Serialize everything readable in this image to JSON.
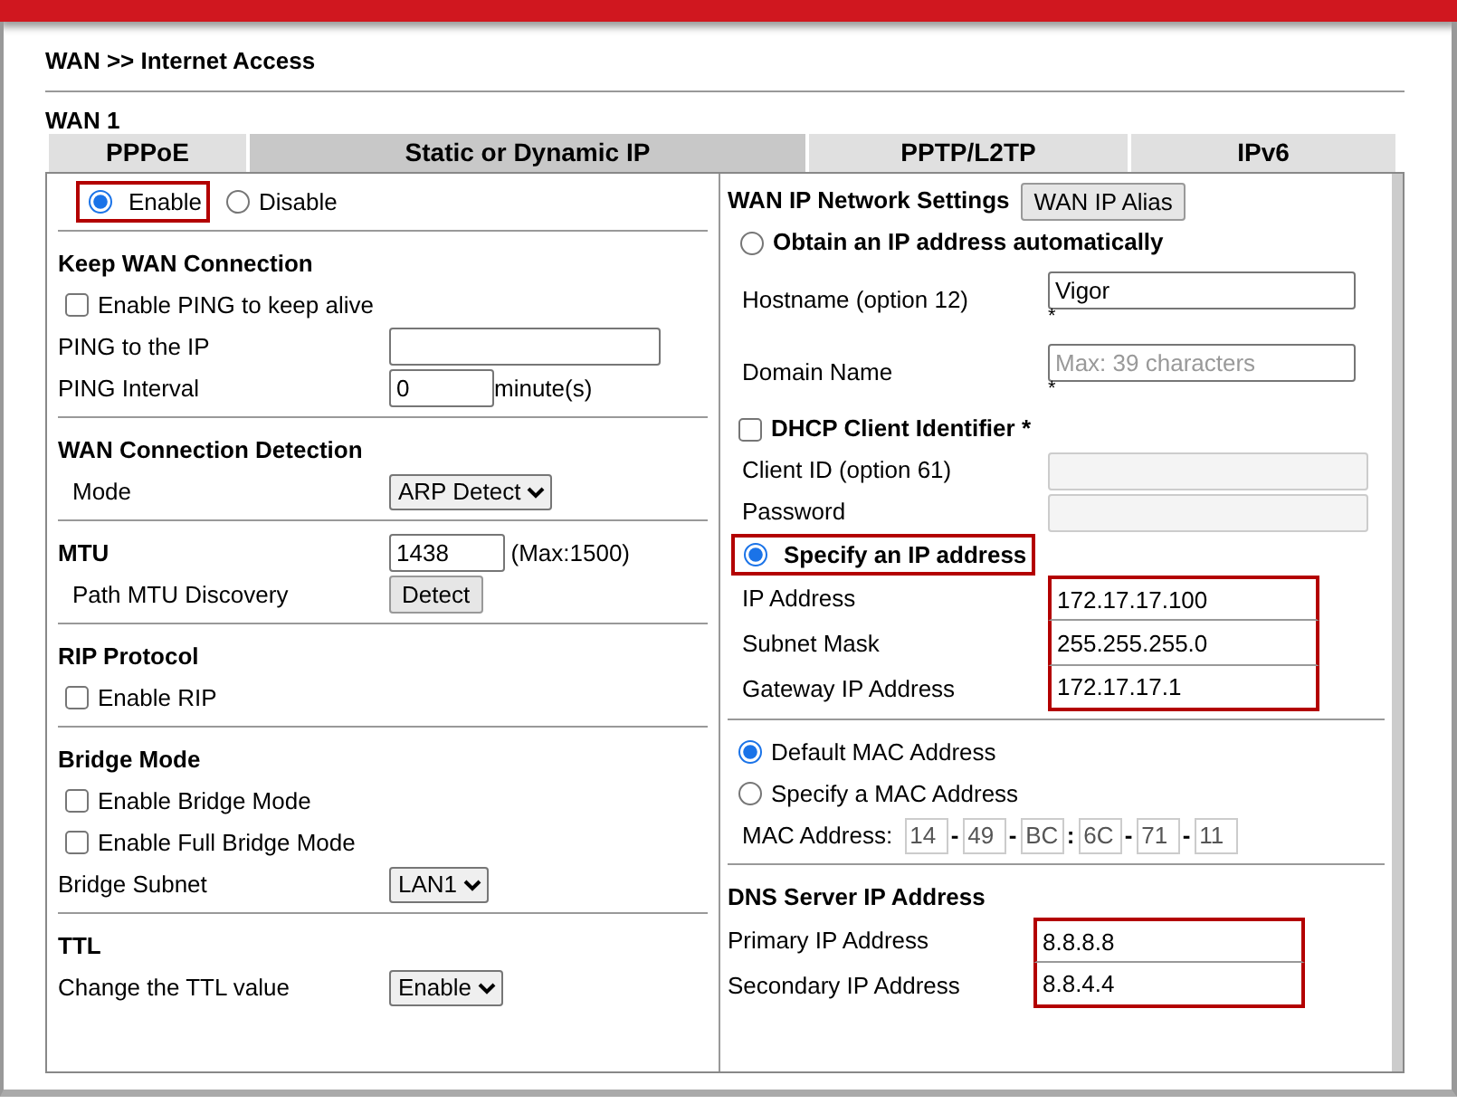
{
  "page_title": "WAN >> Internet Access",
  "wan_label": "WAN 1",
  "tabs": [
    {
      "label": "PPPoE",
      "selected": false
    },
    {
      "label": "Static or Dynamic IP",
      "selected": true
    },
    {
      "label": "PPTP/L2TP",
      "selected": false
    },
    {
      "label": "IPv6",
      "selected": false
    }
  ],
  "left": {
    "enable_options": {
      "highlighted": true,
      "options": [
        {
          "label": "Enable",
          "selected": true
        },
        {
          "label": "Disable",
          "selected": false
        }
      ]
    },
    "sections": [
      {
        "title": "Keep WAN Connection",
        "rows": [
          {
            "kind": "check",
            "label": "Enable PING to keep alive",
            "checked": false
          },
          {
            "kind": "field",
            "label": "PING to the IP"
          },
          {
            "kind": "field",
            "label": "PING Interval",
            "value": "0",
            "suffix": "minute(s)"
          }
        ]
      },
      {
        "title": "WAN Connection Detection",
        "rows": [
          {
            "kind": "select",
            "label": "Mode",
            "value": "ARP Detect"
          }
        ]
      },
      {
        "title": "MTU",
        "value": "1438",
        "suffix": "(Max:1500)",
        "rows": [
          {
            "kind": "button",
            "label": "Path MTU Discovery",
            "button": "Detect"
          }
        ]
      },
      {
        "title": "RIP Protocol",
        "rows": [
          {
            "kind": "check",
            "label": "Enable RIP",
            "checked": false
          }
        ]
      },
      {
        "title": "Bridge Mode",
        "rows": [
          {
            "kind": "check",
            "label": "Enable Bridge Mode",
            "checked": false
          },
          {
            "kind": "check",
            "label": "Enable Full Bridge Mode",
            "checked": false
          },
          {
            "kind": "select",
            "label": "Bridge Subnet",
            "value": "LAN1"
          }
        ]
      },
      {
        "title": "TTL",
        "rows": [
          {
            "kind": "select",
            "label": "Change the TTL value",
            "value": "Enable"
          }
        ]
      }
    ]
  },
  "right": {
    "sections": [
      {
        "title": "WAN IP Network Settings",
        "button": "WAN IP Alias",
        "rows": [
          {
            "kind": "radio",
            "label": "Obtain an IP address automatically",
            "selected": false,
            "highlighted": false
          },
          {
            "kind": "field",
            "label": "Hostname (option 12)",
            "value": "Vigor",
            "note": "*"
          },
          {
            "kind": "field",
            "label": "Domain Name",
            "placeholder": "Max: 39 characters",
            "note": "*"
          },
          {
            "kind": "check",
            "label": "DHCP Client Identifier *",
            "checked": false
          },
          {
            "kind": "field",
            "label": "Client ID (option 61)",
            "disabled": true
          },
          {
            "kind": "field",
            "label": "Password",
            "disabled": true
          },
          {
            "kind": "radio",
            "label": "Specify an IP address",
            "selected": true,
            "highlighted": true
          },
          {
            "kind": "group",
            "highlighted": true,
            "rows": [
              {
                "label": "IP Address",
                "value": "172.17.17.100"
              },
              {
                "label": "Subnet Mask",
                "value": "255.255.255.0"
              },
              {
                "label": "Gateway IP Address",
                "value": "172.17.17.1"
              }
            ]
          }
        ]
      },
      {
        "rows": [
          {
            "kind": "mradio",
            "label": "Default MAC Address",
            "selected": true
          },
          {
            "kind": "mradio",
            "label": "Specify a MAC Address",
            "selected": false
          },
          {
            "kind": "mac",
            "label": "MAC Address:",
            "octets": [
              {
                "value": "14"
              },
              {
                "sep": "-",
                "value": "49"
              },
              {
                "sep": "-",
                "value": "BC"
              },
              {
                "sep": ":",
                "value": "6C"
              },
              {
                "sep": "-",
                "value": "71"
              },
              {
                "sep": "-",
                "value": "11"
              }
            ]
          }
        ]
      },
      {
        "title": "DNS Server IP Address",
        "rows": [
          {
            "kind": "group",
            "highlighted": true,
            "rows": [
              {
                "label": "Primary IP Address",
                "value": "8.8.8.8"
              },
              {
                "label": "Secondary IP Address",
                "value": "8.8.4.4"
              }
            ]
          }
        ]
      }
    ]
  }
}
